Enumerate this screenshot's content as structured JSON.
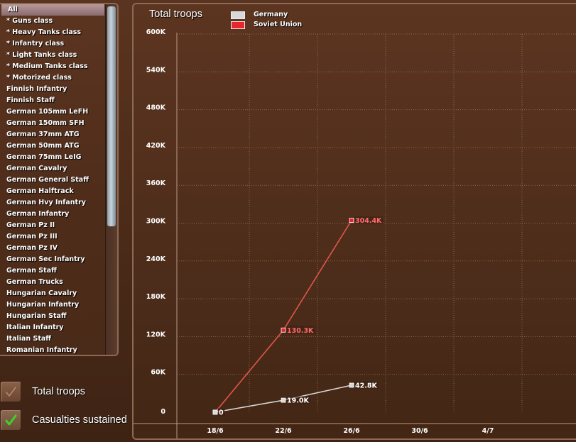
{
  "unit_list": {
    "selected_index": 0,
    "items": [
      "All",
      "* Guns class",
      "* Heavy Tanks class",
      "* Infantry class",
      "* Light Tanks class",
      "* Medium Tanks class",
      "* Motorized class",
      "Finnish Infantry",
      "Finnish Staff",
      "German 105mm LeFH",
      "German 150mm SFH",
      "German 37mm ATG",
      "German 50mm ATG",
      "German 75mm LeIG",
      "German Cavalry",
      "German General Staff",
      "German Halftrack",
      "German Hvy Infantry",
      "German Infantry",
      "German Pz II",
      "German Pz III",
      "German Pz IV",
      "German Sec Infantry",
      "German Staff",
      "German Trucks",
      "Hungarian Cavalry",
      "Hungarian Infantry",
      "Hungarian Staff",
      "Italian Infantry",
      "Italian Staff",
      "Romanian Infantry"
    ]
  },
  "toggles": {
    "total_troops": {
      "label": "Total troops",
      "checked": true,
      "icon": "faded-check-icon"
    },
    "casualties": {
      "label": "Casualties sustained",
      "checked": true,
      "icon": "green-check-icon"
    }
  },
  "colors": {
    "germany": "#d8d8d8",
    "soviet": "#e8242c",
    "soviet_line": "#e0564a",
    "check_green": "#3fd22a"
  },
  "chart_data": {
    "type": "line",
    "title": "Total troops",
    "categories": [
      "18/6",
      "22/6",
      "26/6",
      "30/6",
      "4/7"
    ],
    "ylim": [
      0,
      600000
    ],
    "yticks": [
      "0",
      "60K",
      "120K",
      "180K",
      "240K",
      "300K",
      "360K",
      "420K",
      "480K",
      "540K",
      "600K"
    ],
    "grid": true,
    "legend_position": "top-left",
    "series": [
      {
        "name": "Germany",
        "color": "#d8d8d8",
        "values": [
          0,
          19000,
          42800
        ],
        "labels": [
          "0",
          "19.0K",
          "42.8K"
        ]
      },
      {
        "name": "Soviet Union",
        "color": "#e8242c",
        "values": [
          0,
          130300,
          304400
        ],
        "labels": [
          "0",
          "130.3K",
          "304.4K"
        ]
      }
    ]
  }
}
